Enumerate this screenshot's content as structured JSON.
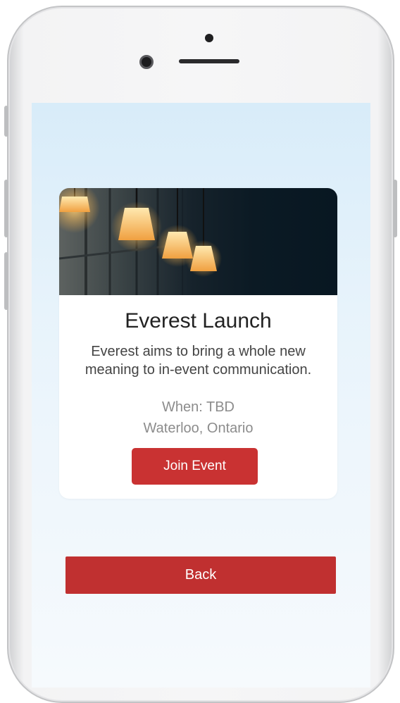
{
  "event": {
    "title": "Everest Launch",
    "description": "Everest aims to bring a whole new meaning to in-event communication.",
    "when": "When: TBD",
    "location": "Waterloo, Ontario",
    "join_label": "Join Event"
  },
  "footer": {
    "back_label": "Back"
  },
  "colors": {
    "join_button": "#c93232",
    "back_button": "#c03030",
    "screen_background": "#e3f1fb"
  }
}
